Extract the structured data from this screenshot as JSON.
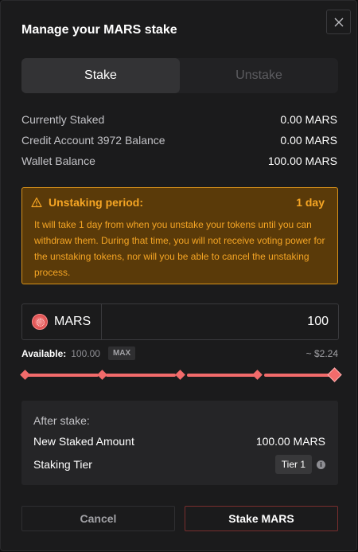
{
  "modal": {
    "title": "Manage your MARS stake"
  },
  "tabs": [
    {
      "label": "Stake",
      "active": true
    },
    {
      "label": "Unstake",
      "active": false
    }
  ],
  "balances": [
    {
      "label": "Currently Staked",
      "value": "0.00 MARS"
    },
    {
      "label": "Credit Account 3972 Balance",
      "value": "0.00 MARS"
    },
    {
      "label": "Wallet Balance",
      "value": "100.00 MARS"
    }
  ],
  "warning": {
    "title": "Unstaking period:",
    "duration": "1 day",
    "body": "It will take 1 day from when you unstake your tokens until you can withdraw them. During that time, you will not receive voting power for the unstaking tokens, nor will you be able to cancel the unstaking process.",
    "color": "#f5a524"
  },
  "asset": {
    "symbol": "MARS",
    "amount": "100"
  },
  "available": {
    "label": "Available:",
    "value": "100.00",
    "max_label": "MAX",
    "usd": "~ $2.24"
  },
  "slider": {
    "percent": 100,
    "color": "#f26b6b"
  },
  "after_stake": {
    "title": "After stake:",
    "new_staked_label": "New Staked Amount",
    "new_staked_value": "100.00 MARS",
    "tier_label": "Staking Tier",
    "tier_value": "Tier 1",
    "info_glyph": "i"
  },
  "buttons": {
    "cancel": "Cancel",
    "stake": "Stake MARS"
  }
}
